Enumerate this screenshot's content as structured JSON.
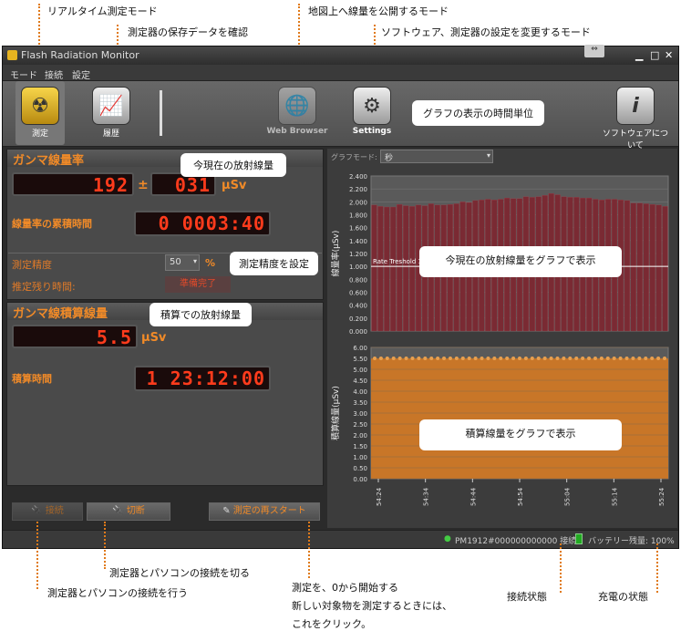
{
  "callouts": {
    "realtime": "リアルタイム測定モード",
    "history": "測定器の保存データを確認",
    "webmap": "地図上へ線量を公開するモード",
    "settings": "ソフトウェア、測定器の設定を変更するモード",
    "disconnect": "測定器とパソコンの接続を切る",
    "connect": "測定器とパソコンの接続を行う",
    "restart_1": "測定を、0から開始する",
    "restart_2": "新しい対象物を測定するときには、",
    "restart_3": "これをクリック。",
    "conn_state": "接続状態",
    "charge_state": "充電の状態"
  },
  "bubbles": {
    "current_dose": "今現在の放射線量",
    "chart_unit": "グラフの表示の時間単位",
    "accuracy": "測定精度を設定",
    "accum": "積算での放射線量",
    "dose_chart": "今現在の放射線量をグラフで表示",
    "accum_chart": "積算線量をグラフで表示"
  },
  "window": {
    "title": "Flash Radiation Monitor",
    "menu": [
      "モード",
      "接続",
      "設定"
    ]
  },
  "toolbar": {
    "measure": "測定",
    "history": "履歴",
    "web": "Web Browser",
    "settings": "Settings",
    "about": "ソフトウェアについて"
  },
  "gamma": {
    "title": "ガンマ線量率",
    "rate": "192",
    "pm": "±",
    "err": "031",
    "unit": "μSv",
    "time_label": "線量率の累積時間",
    "time": "0 0003:40",
    "accuracy_label": "測定精度",
    "accuracy_value": "50",
    "accuracy_unit": "%",
    "remain_label": "推定残り時間:",
    "remain_value": "準備完了"
  },
  "accum": {
    "title": "ガンマ線積算線量",
    "value": "5.5",
    "unit": "μSv",
    "time_label": "積算時間",
    "time": "1 23:12:00"
  },
  "buttons": {
    "connect": "接続",
    "disconnect": "切断",
    "restart": "測定の再スタート"
  },
  "graph": {
    "mode_label": "グラフモード:",
    "mode_value": "秒"
  },
  "status": {
    "connection": "PM1912#000000000000 接続",
    "battery": "バッテリー残量: 100%"
  },
  "chart_data": [
    {
      "type": "bar",
      "ylabel": "線量率(μSv)",
      "ylim": [
        0,
        2.4
      ],
      "yticks": [
        "0.000",
        "0.200",
        "0.400",
        "0.600",
        "0.800",
        "1.000",
        "1.200",
        "1.400",
        "1.600",
        "1.800",
        "2.000",
        "2.200",
        "2.400"
      ],
      "threshold_label": "Rate Treshold 1",
      "threshold": 1.0,
      "values": [
        1.95,
        1.93,
        1.92,
        1.92,
        1.96,
        1.94,
        1.93,
        1.95,
        1.94,
        1.97,
        1.95,
        1.95,
        1.96,
        1.97,
        2.0,
        1.99,
        2.02,
        2.03,
        2.04,
        2.03,
        2.04,
        2.06,
        2.05,
        2.05,
        2.08,
        2.07,
        2.08,
        2.1,
        2.13,
        2.11,
        2.08,
        2.07,
        2.07,
        2.06,
        2.06,
        2.04,
        2.03,
        2.04,
        2.04,
        2.03,
        2.02,
        1.98,
        1.98,
        1.97,
        1.96,
        1.95,
        1.93
      ],
      "color": "#7a2a33"
    },
    {
      "type": "area",
      "ylabel": "積算線量(μSv)",
      "ylim": [
        0,
        6.0
      ],
      "yticks": [
        "0.00",
        "0.50",
        "1.00",
        "1.50",
        "2.00",
        "2.50",
        "3.00",
        "3.50",
        "4.00",
        "4.50",
        "5.00",
        "5.50",
        "6.00"
      ],
      "value": 5.5,
      "xticks": [
        "54:24",
        "54:34",
        "54:44",
        "54:54",
        "55:04",
        "55:14",
        "55:24"
      ],
      "color": "#c87628"
    }
  ]
}
